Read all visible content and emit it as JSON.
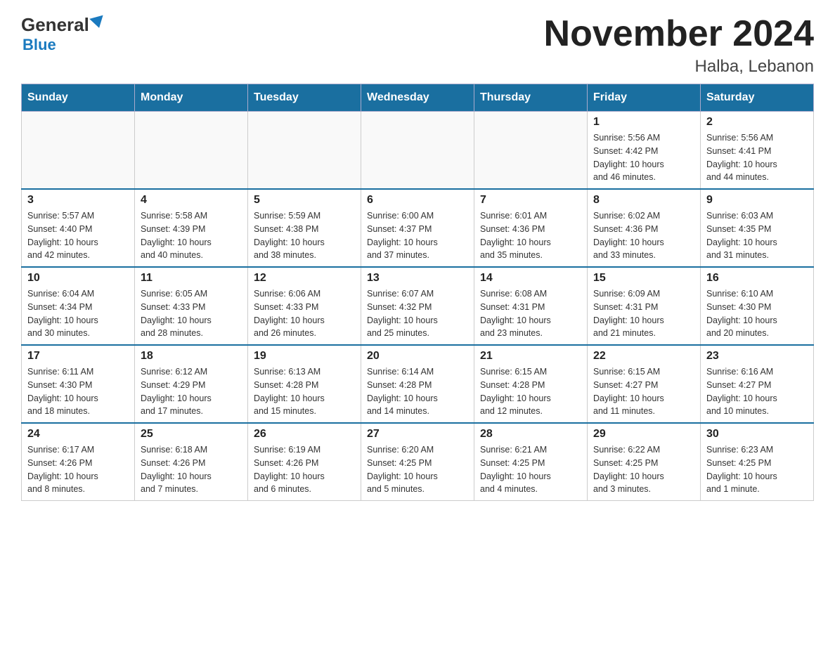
{
  "logo": {
    "general": "General",
    "blue": "Blue"
  },
  "title": "November 2024",
  "location": "Halba, Lebanon",
  "days_of_week": [
    "Sunday",
    "Monday",
    "Tuesday",
    "Wednesday",
    "Thursday",
    "Friday",
    "Saturday"
  ],
  "weeks": [
    [
      {
        "day": "",
        "info": ""
      },
      {
        "day": "",
        "info": ""
      },
      {
        "day": "",
        "info": ""
      },
      {
        "day": "",
        "info": ""
      },
      {
        "day": "",
        "info": ""
      },
      {
        "day": "1",
        "info": "Sunrise: 5:56 AM\nSunset: 4:42 PM\nDaylight: 10 hours\nand 46 minutes."
      },
      {
        "day": "2",
        "info": "Sunrise: 5:56 AM\nSunset: 4:41 PM\nDaylight: 10 hours\nand 44 minutes."
      }
    ],
    [
      {
        "day": "3",
        "info": "Sunrise: 5:57 AM\nSunset: 4:40 PM\nDaylight: 10 hours\nand 42 minutes."
      },
      {
        "day": "4",
        "info": "Sunrise: 5:58 AM\nSunset: 4:39 PM\nDaylight: 10 hours\nand 40 minutes."
      },
      {
        "day": "5",
        "info": "Sunrise: 5:59 AM\nSunset: 4:38 PM\nDaylight: 10 hours\nand 38 minutes."
      },
      {
        "day": "6",
        "info": "Sunrise: 6:00 AM\nSunset: 4:37 PM\nDaylight: 10 hours\nand 37 minutes."
      },
      {
        "day": "7",
        "info": "Sunrise: 6:01 AM\nSunset: 4:36 PM\nDaylight: 10 hours\nand 35 minutes."
      },
      {
        "day": "8",
        "info": "Sunrise: 6:02 AM\nSunset: 4:36 PM\nDaylight: 10 hours\nand 33 minutes."
      },
      {
        "day": "9",
        "info": "Sunrise: 6:03 AM\nSunset: 4:35 PM\nDaylight: 10 hours\nand 31 minutes."
      }
    ],
    [
      {
        "day": "10",
        "info": "Sunrise: 6:04 AM\nSunset: 4:34 PM\nDaylight: 10 hours\nand 30 minutes."
      },
      {
        "day": "11",
        "info": "Sunrise: 6:05 AM\nSunset: 4:33 PM\nDaylight: 10 hours\nand 28 minutes."
      },
      {
        "day": "12",
        "info": "Sunrise: 6:06 AM\nSunset: 4:33 PM\nDaylight: 10 hours\nand 26 minutes."
      },
      {
        "day": "13",
        "info": "Sunrise: 6:07 AM\nSunset: 4:32 PM\nDaylight: 10 hours\nand 25 minutes."
      },
      {
        "day": "14",
        "info": "Sunrise: 6:08 AM\nSunset: 4:31 PM\nDaylight: 10 hours\nand 23 minutes."
      },
      {
        "day": "15",
        "info": "Sunrise: 6:09 AM\nSunset: 4:31 PM\nDaylight: 10 hours\nand 21 minutes."
      },
      {
        "day": "16",
        "info": "Sunrise: 6:10 AM\nSunset: 4:30 PM\nDaylight: 10 hours\nand 20 minutes."
      }
    ],
    [
      {
        "day": "17",
        "info": "Sunrise: 6:11 AM\nSunset: 4:30 PM\nDaylight: 10 hours\nand 18 minutes."
      },
      {
        "day": "18",
        "info": "Sunrise: 6:12 AM\nSunset: 4:29 PM\nDaylight: 10 hours\nand 17 minutes."
      },
      {
        "day": "19",
        "info": "Sunrise: 6:13 AM\nSunset: 4:28 PM\nDaylight: 10 hours\nand 15 minutes."
      },
      {
        "day": "20",
        "info": "Sunrise: 6:14 AM\nSunset: 4:28 PM\nDaylight: 10 hours\nand 14 minutes."
      },
      {
        "day": "21",
        "info": "Sunrise: 6:15 AM\nSunset: 4:28 PM\nDaylight: 10 hours\nand 12 minutes."
      },
      {
        "day": "22",
        "info": "Sunrise: 6:15 AM\nSunset: 4:27 PM\nDaylight: 10 hours\nand 11 minutes."
      },
      {
        "day": "23",
        "info": "Sunrise: 6:16 AM\nSunset: 4:27 PM\nDaylight: 10 hours\nand 10 minutes."
      }
    ],
    [
      {
        "day": "24",
        "info": "Sunrise: 6:17 AM\nSunset: 4:26 PM\nDaylight: 10 hours\nand 8 minutes."
      },
      {
        "day": "25",
        "info": "Sunrise: 6:18 AM\nSunset: 4:26 PM\nDaylight: 10 hours\nand 7 minutes."
      },
      {
        "day": "26",
        "info": "Sunrise: 6:19 AM\nSunset: 4:26 PM\nDaylight: 10 hours\nand 6 minutes."
      },
      {
        "day": "27",
        "info": "Sunrise: 6:20 AM\nSunset: 4:25 PM\nDaylight: 10 hours\nand 5 minutes."
      },
      {
        "day": "28",
        "info": "Sunrise: 6:21 AM\nSunset: 4:25 PM\nDaylight: 10 hours\nand 4 minutes."
      },
      {
        "day": "29",
        "info": "Sunrise: 6:22 AM\nSunset: 4:25 PM\nDaylight: 10 hours\nand 3 minutes."
      },
      {
        "day": "30",
        "info": "Sunrise: 6:23 AM\nSunset: 4:25 PM\nDaylight: 10 hours\nand 1 minute."
      }
    ]
  ]
}
